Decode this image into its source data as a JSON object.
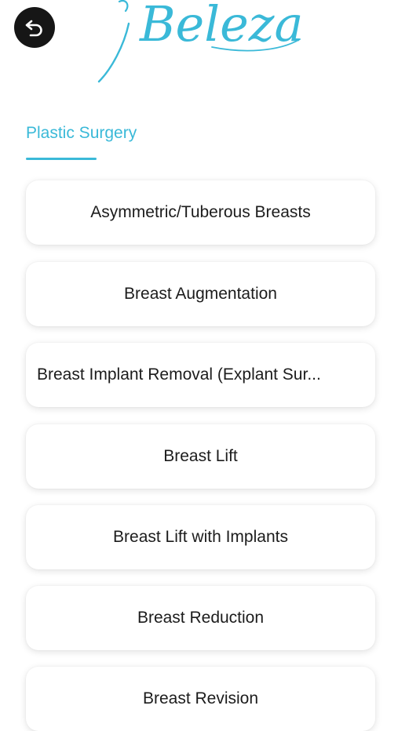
{
  "header": {
    "back_icon": "back-arrow-icon",
    "logo_text": "Beleza",
    "colors": {
      "accent": "#3ab9d8",
      "back_button_bg": "#161616"
    }
  },
  "section": {
    "title": "Plastic Surgery"
  },
  "procedures": [
    {
      "label": "Asymmetric/Tuberous Breasts"
    },
    {
      "label": "Breast Augmentation"
    },
    {
      "label": "Breast Implant Removal (Explant Sur..."
    },
    {
      "label": "Breast Lift"
    },
    {
      "label": "Breast Lift with Implants"
    },
    {
      "label": "Breast Reduction"
    },
    {
      "label": "Breast Revision"
    }
  ]
}
